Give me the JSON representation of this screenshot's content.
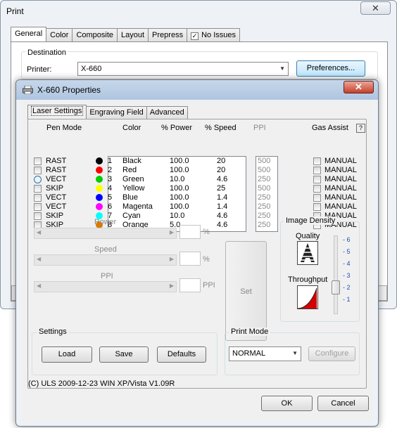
{
  "print_dialog": {
    "title": "Print",
    "close_label": "✕",
    "tabs": [
      "General",
      "Color",
      "Composite",
      "Layout",
      "Prepress",
      "No Issues"
    ],
    "destination_label": "Destination",
    "printer_label": "Printer:",
    "printer_value": "X-660",
    "preferences_label": "Preferences..."
  },
  "properties": {
    "title": "X-660 Properties",
    "close_label": "✕",
    "tabs": [
      "Laser Settings",
      "Engraving Field",
      "Advanced"
    ],
    "headers": {
      "pen_mode": "Pen Mode",
      "color": "Color",
      "power": "% Power",
      "speed": "% Speed",
      "ppi": "PPI",
      "gas_assist": "Gas Assist",
      "help": "?"
    },
    "pens": [
      {
        "mode": "RAST",
        "num": "1",
        "color": "Black",
        "swatch": "#000000",
        "power": "100.0",
        "speed": "20",
        "ppi": "500",
        "gas": "MANUAL"
      },
      {
        "mode": "RAST",
        "num": "2",
        "color": "Red",
        "swatch": "#ff0000",
        "power": "100.0",
        "speed": "20",
        "ppi": "500",
        "gas": "MANUAL"
      },
      {
        "mode": "VECT",
        "num": "3",
        "color": "Green",
        "swatch": "#00cc00",
        "power": "10.0",
        "speed": "4.6",
        "ppi": "250",
        "gas": "MANUAL"
      },
      {
        "mode": "SKIP",
        "num": "4",
        "color": "Yellow",
        "swatch": "#ffff00",
        "power": "100.0",
        "speed": "25",
        "ppi": "500",
        "gas": "MANUAL"
      },
      {
        "mode": "VECT",
        "num": "5",
        "color": "Blue",
        "swatch": "#0000ff",
        "power": "100.0",
        "speed": "1.4",
        "ppi": "250",
        "gas": "MANUAL"
      },
      {
        "mode": "VECT",
        "num": "6",
        "color": "Magenta",
        "swatch": "#ff00ff",
        "power": "100.0",
        "speed": "1.4",
        "ppi": "250",
        "gas": "MANUAL"
      },
      {
        "mode": "SKIP",
        "num": "7",
        "color": "Cyan",
        "swatch": "#00ffff",
        "power": "10.0",
        "speed": "4.6",
        "ppi": "250",
        "gas": "MANUAL"
      },
      {
        "mode": "SKIP",
        "num": "8",
        "color": "Orange",
        "swatch": "#d97a00",
        "power": "5.0",
        "speed": "4.6",
        "ppi": "250",
        "gas": "MANUAL"
      }
    ],
    "selected_pen_mode_index": 2,
    "sliders": {
      "power_label": "Power",
      "power_unit": "%",
      "speed_label": "Speed",
      "speed_unit": "%",
      "ppi_label": "PPI",
      "ppi_unit": "PPI"
    },
    "set_label": "Set",
    "image_density": {
      "label": "Image Density",
      "quality_label": "Quality",
      "throughput_label": "Throughput",
      "ticks": [
        "6",
        "5",
        "4",
        "3",
        "2",
        "1"
      ],
      "selected": "2"
    },
    "settings": {
      "label": "Settings",
      "load": "Load",
      "save": "Save",
      "defaults": "Defaults"
    },
    "print_mode": {
      "label": "Print Mode",
      "value": "NORMAL",
      "configure": "Configure"
    },
    "copyright": "(C) ULS 2009-12-23 WIN XP/Vista V1.09R",
    "ok": "OK",
    "cancel": "Cancel"
  }
}
